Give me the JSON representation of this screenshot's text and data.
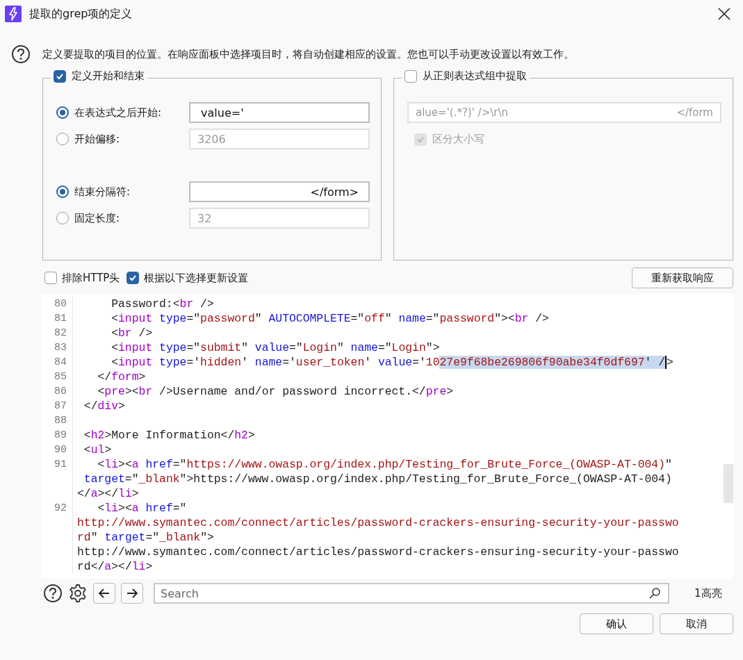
{
  "window": {
    "title": "提取的grep项的定义"
  },
  "info": "定义要提取的项目的位置。在响应面板中选择项目时，将自动创建相应的设置。您也可以手动更改设置以有效工作。",
  "start_end": {
    "label": "定义开始和结束",
    "checked": true,
    "groups": [
      {
        "options": [
          {
            "label": "在表达式之后开始:",
            "selected": true,
            "value": " value='"
          },
          {
            "label": "开始偏移:",
            "selected": false,
            "value": "3206"
          }
        ]
      },
      {
        "options": [
          {
            "label": "结束分隔符:",
            "selected": true,
            "value": "</form>"
          },
          {
            "label": "固定长度:",
            "selected": false,
            "value": "32"
          }
        ]
      }
    ]
  },
  "regex_group": {
    "label": "从正则表达式组中提取",
    "checked": false,
    "field_left": "alue='(.*?)' />\\r\\n",
    "field_right": "</form",
    "case_sensitive": {
      "label": "区分大小写",
      "checked": true
    }
  },
  "options": [
    {
      "label": "排除HTTP头",
      "checked": false
    },
    {
      "label": "根据以下选择更新设置",
      "checked": true
    }
  ],
  "refetch_button": "重新获取响应",
  "code": {
    "lines": [
      {
        "number": "80",
        "rows": [
          {
            "tokens": [
              {
                "kind": "text",
                "text": "     Password:<"
              },
              {
                "kind": "tag",
                "text": "br"
              },
              {
                "kind": "text",
                "text": " />"
              }
            ]
          }
        ]
      },
      {
        "number": "81",
        "rows": [
          {
            "tokens": [
              {
                "kind": "text",
                "text": "     <"
              },
              {
                "kind": "tag",
                "text": "input"
              },
              {
                "kind": "attr",
                "text": " type"
              },
              {
                "kind": "text",
                "text": "=\""
              },
              {
                "kind": "str",
                "text": "password"
              },
              {
                "kind": "text",
                "text": "\" "
              },
              {
                "kind": "attr",
                "text": "AUTOCOMPLETE"
              },
              {
                "kind": "text",
                "text": "=\""
              },
              {
                "kind": "str",
                "text": "off"
              },
              {
                "kind": "text",
                "text": "\" "
              },
              {
                "kind": "attr",
                "text": "name"
              },
              {
                "kind": "text",
                "text": "=\""
              },
              {
                "kind": "str",
                "text": "password"
              },
              {
                "kind": "text",
                "text": "\"><"
              },
              {
                "kind": "tag",
                "text": "br"
              },
              {
                "kind": "text",
                "text": " />"
              }
            ]
          }
        ]
      },
      {
        "number": "82",
        "rows": [
          {
            "tokens": [
              {
                "kind": "text",
                "text": "     <"
              },
              {
                "kind": "tag",
                "text": "br"
              },
              {
                "kind": "text",
                "text": " />"
              }
            ]
          }
        ]
      },
      {
        "number": "83",
        "rows": [
          {
            "tokens": [
              {
                "kind": "text",
                "text": "     <"
              },
              {
                "kind": "tag",
                "text": "input"
              },
              {
                "kind": "attr",
                "text": " type"
              },
              {
                "kind": "text",
                "text": "=\""
              },
              {
                "kind": "str",
                "text": "submit"
              },
              {
                "kind": "text",
                "text": "\" "
              },
              {
                "kind": "attr",
                "text": "value"
              },
              {
                "kind": "text",
                "text": "=\""
              },
              {
                "kind": "str",
                "text": "Login"
              },
              {
                "kind": "text",
                "text": "\" "
              },
              {
                "kind": "attr",
                "text": "name"
              },
              {
                "kind": "text",
                "text": "=\""
              },
              {
                "kind": "str",
                "text": "Login"
              },
              {
                "kind": "text",
                "text": "\">"
              }
            ]
          }
        ]
      },
      {
        "number": "84",
        "rows": [
          {
            "tokens": [
              {
                "kind": "text",
                "text": "     <"
              },
              {
                "kind": "tag",
                "text": "input"
              },
              {
                "kind": "attr",
                "text": " type"
              },
              {
                "kind": "text",
                "text": "='"
              },
              {
                "kind": "str",
                "text": "hidden"
              },
              {
                "kind": "text",
                "text": "' "
              },
              {
                "kind": "attr",
                "text": "name"
              },
              {
                "kind": "text",
                "text": "='"
              },
              {
                "kind": "str",
                "text": "user_token"
              },
              {
                "kind": "text",
                "text": "' "
              },
              {
                "kind": "attr",
                "text": "value"
              },
              {
                "kind": "text",
                "text": "='"
              },
              {
                "kind": "str",
                "text": "10"
              },
              {
                "kind": "str",
                "text": "27e9f68be269806f90abe34f0df697",
                "highlighted": true
              },
              {
                "kind": "text",
                "text": "' /",
                "highlighted": true
              },
              {
                "kind": "text",
                "text": ">"
              }
            ]
          }
        ]
      },
      {
        "number": "85",
        "rows": [
          {
            "tokens": [
              {
                "kind": "text",
                "text": "   </"
              },
              {
                "kind": "tag",
                "text": "form"
              },
              {
                "kind": "text",
                "text": ">"
              }
            ]
          }
        ]
      },
      {
        "number": "86",
        "rows": [
          {
            "tokens": [
              {
                "kind": "text",
                "text": "   <"
              },
              {
                "kind": "tag",
                "text": "pre"
              },
              {
                "kind": "text",
                "text": "><"
              },
              {
                "kind": "tag",
                "text": "br"
              },
              {
                "kind": "text",
                "text": " />Username and/or password incorrect.</"
              },
              {
                "kind": "tag",
                "text": "pre"
              },
              {
                "kind": "text",
                "text": ">"
              }
            ]
          }
        ]
      },
      {
        "number": "87",
        "rows": [
          {
            "tokens": [
              {
                "kind": "text",
                "text": " </"
              },
              {
                "kind": "tag",
                "text": "div"
              },
              {
                "kind": "text",
                "text": ">"
              }
            ]
          }
        ]
      },
      {
        "number": "88",
        "rows": [
          {
            "tokens": []
          }
        ]
      },
      {
        "number": "89",
        "rows": [
          {
            "tokens": [
              {
                "kind": "text",
                "text": " <"
              },
              {
                "kind": "tag",
                "text": "h2"
              },
              {
                "kind": "text",
                "text": ">More Information</"
              },
              {
                "kind": "tag",
                "text": "h2"
              },
              {
                "kind": "text",
                "text": ">"
              }
            ]
          }
        ]
      },
      {
        "number": "90",
        "rows": [
          {
            "tokens": [
              {
                "kind": "text",
                "text": " <"
              },
              {
                "kind": "tag",
                "text": "ul"
              },
              {
                "kind": "text",
                "text": ">"
              }
            ]
          }
        ]
      },
      {
        "number": "91",
        "rows": [
          {
            "tokens": [
              {
                "kind": "text",
                "text": "   <"
              },
              {
                "kind": "tag",
                "text": "li"
              },
              {
                "kind": "text",
                "text": "><"
              },
              {
                "kind": "tag",
                "text": "a"
              },
              {
                "kind": "attr",
                "text": " href"
              },
              {
                "kind": "text",
                "text": "=\""
              },
              {
                "kind": "str",
                "text": "https://www.owasp.org/index.php/Testing_for_Brute_Force_(OWASP-AT-004)"
              },
              {
                "kind": "text",
                "text": "\""
              }
            ]
          },
          {
            "tokens": [
              {
                "kind": "attr",
                "text": " target"
              },
              {
                "kind": "text",
                "text": "=\""
              },
              {
                "kind": "str",
                "text": "_blank"
              },
              {
                "kind": "text",
                "text": "\">https://www.owasp.org/index.php/Testing_for_Brute_Force_(OWASP-AT-004)"
              }
            ]
          },
          {
            "tokens": [
              {
                "kind": "text",
                "text": "</"
              },
              {
                "kind": "tag",
                "text": "a"
              },
              {
                "kind": "text",
                "text": "></"
              },
              {
                "kind": "tag",
                "text": "li"
              },
              {
                "kind": "text",
                "text": ">"
              }
            ]
          }
        ]
      },
      {
        "number": "92",
        "rows": [
          {
            "tokens": [
              {
                "kind": "text",
                "text": "   <"
              },
              {
                "kind": "tag",
                "text": "li"
              },
              {
                "kind": "text",
                "text": "><"
              },
              {
                "kind": "tag",
                "text": "a"
              },
              {
                "kind": "attr",
                "text": " href"
              },
              {
                "kind": "text",
                "text": "=\""
              }
            ]
          },
          {
            "tokens": [
              {
                "kind": "str",
                "text": "http://www.symantec.com/connect/articles/password-crackers-ensuring-security-your-passwo"
              }
            ]
          },
          {
            "tokens": [
              {
                "kind": "str",
                "text": "rd"
              },
              {
                "kind": "text",
                "text": "\" "
              },
              {
                "kind": "attr",
                "text": "target"
              },
              {
                "kind": "text",
                "text": "=\""
              },
              {
                "kind": "str",
                "text": "_blank"
              },
              {
                "kind": "text",
                "text": "\">"
              }
            ]
          },
          {
            "tokens": [
              {
                "kind": "text",
                "text": "http://www.symantec.com/connect/articles/password-crackers-ensuring-security-your-passwo"
              }
            ]
          },
          {
            "tokens": [
              {
                "kind": "text",
                "text": "rd</"
              },
              {
                "kind": "tag",
                "text": "a"
              },
              {
                "kind": "text",
                "text": "></"
              },
              {
                "kind": "tag",
                "text": "li"
              },
              {
                "kind": "text",
                "text": ">"
              }
            ]
          }
        ]
      }
    ]
  },
  "search": {
    "placeholder": "Search",
    "matches": "1高亮"
  },
  "buttons": [
    "确认",
    "取消"
  ]
}
